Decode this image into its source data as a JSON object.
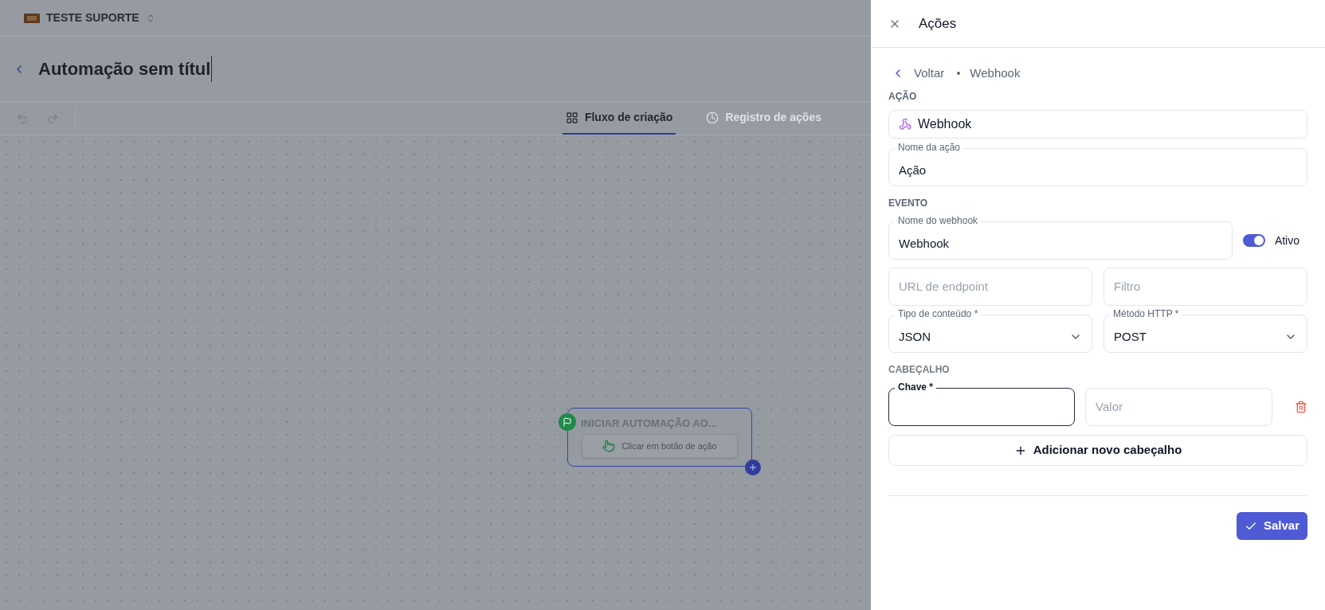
{
  "workspace": {
    "name": "TESTE SUPORTE"
  },
  "automation": {
    "title": "Automação sem títul"
  },
  "view_tabs": [
    {
      "label": "Fluxo de criação",
      "selected": true
    },
    {
      "label": "Registro de ações",
      "selected": false
    }
  ],
  "node": {
    "title": "INICIAR AUTOMAÇÃO AO...",
    "trigger": "Clicar em botão de ação"
  },
  "panel": {
    "title": "Ações",
    "breadcrumb": {
      "back": "Voltar",
      "current": "Webhook"
    },
    "action_heading": "AÇÃO",
    "action_type": "Webhook",
    "action_name": {
      "label": "Nome da ação",
      "value": "Ação"
    },
    "event_heading": "EVENTO",
    "webhook_name": {
      "label": "Nome do webhook",
      "value": "Webhook"
    },
    "active": {
      "label": "Ativo",
      "on": true
    },
    "endpoint": {
      "placeholder": "URL de endpoint"
    },
    "filter": {
      "placeholder": "Filtro"
    },
    "content_type": {
      "label": "Tipo de conteúdo *",
      "value": "JSON"
    },
    "http_method": {
      "label": "Método HTTP *",
      "value": "POST"
    },
    "header_heading": "CABEÇALHO",
    "headers": [
      {
        "key": {
          "label": "Chave *",
          "focused": true
        },
        "value": {
          "placeholder": "Valor"
        }
      }
    ],
    "add_header": "Adicionar novo cabeçalho",
    "save": "Salvar"
  }
}
